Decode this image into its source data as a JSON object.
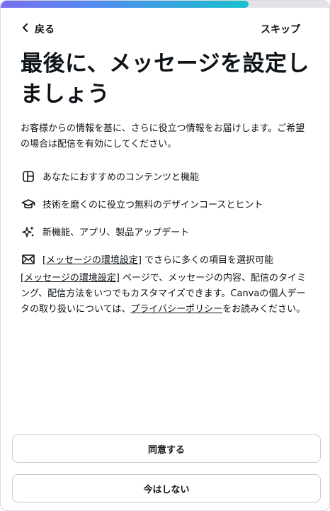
{
  "progress": {
    "fraction": 0.75
  },
  "nav": {
    "back_label": "戻る",
    "skip_label": "スキップ"
  },
  "heading": {
    "title": "最後に、メッセージを設定しましょう"
  },
  "intro": "お客様からの情報を基に、さらに役立つ情報をお届けします。ご希望の場合は配信を有効にしてください。",
  "features": [
    {
      "icon": "layout-icon",
      "label": "あなたにおすすめのコンテンツと機能"
    },
    {
      "icon": "graduation-cap-icon",
      "label": "技術を磨くのに役立つ無料のデザインコースとヒント"
    },
    {
      "icon": "sparkles-icon",
      "label": "新機能、アプリ、製品アップデート"
    }
  ],
  "settings_feature": {
    "icon": "envelope-icon",
    "open_bracket": "[",
    "link_label": "メッセージの環境設定",
    "close_bracket": "]",
    "suffix": " でさらに多くの項目を選択可能"
  },
  "body": {
    "open_bracket": "[",
    "settings_link": "メッセージの環境設定",
    "close_bracket": "]",
    "text_1": " ページで、メッセージの内容、配信のタイミング、配信方法をいつでもカスタマイズできます。Canvaの個人データの取り扱いについては、",
    "privacy_link": "プライバシーポリシー",
    "text_2": "をお読みください。"
  },
  "buttons": {
    "agree_label": "同意する",
    "decline_label": "今はしない"
  }
}
